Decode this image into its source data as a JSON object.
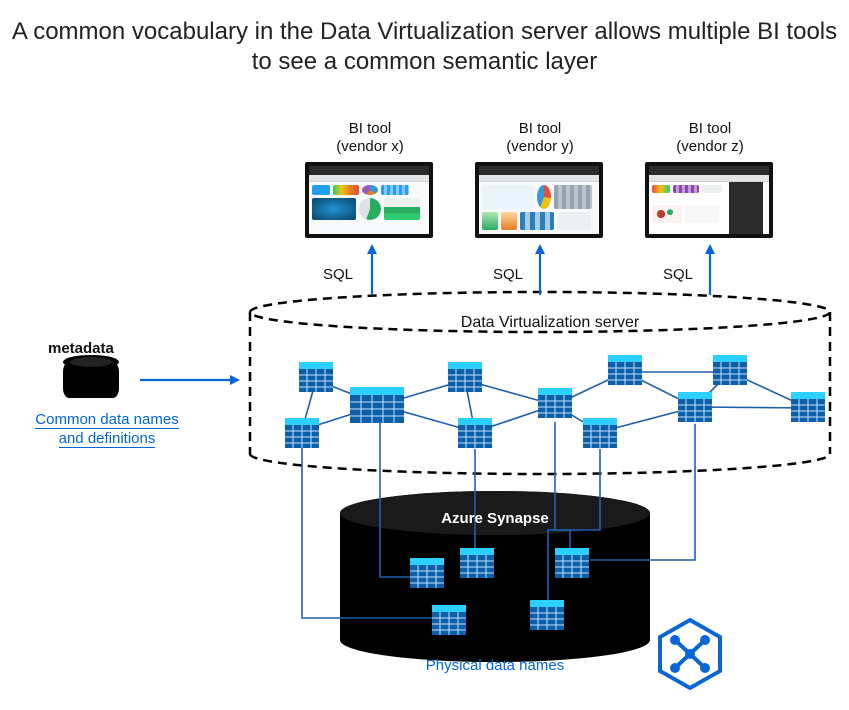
{
  "title": "A common vocabulary in the Data Virtualization server allows multiple BI tools to see a common semantic layer",
  "bi_tools": {
    "x": {
      "line1": "BI tool",
      "line2": "(vendor x)"
    },
    "y": {
      "line1": "BI tool",
      "line2": "(vendor y)"
    },
    "z": {
      "line1": "BI tool",
      "line2": "(vendor z)"
    }
  },
  "sql_label": "SQL",
  "metadata_label": "metadata",
  "common_data_link_l1": "Common",
  "common_data_link_l2": " data names",
  "common_data_link_l3": "and definitions",
  "dv_server_label": "Data Virtualization server",
  "azure_synapse_label": "Azure Synapse",
  "physical_label": "Physical data names",
  "colors": {
    "accent_blue": "#0a66d6",
    "table_header": "#29c0ff",
    "table_cell": "#1f78c8",
    "cylinder": "#000000"
  },
  "icons": {
    "synapse": "synapse-hexagon-icon",
    "database": "database-cylinder-icon",
    "table": "data-table-icon",
    "arrow": "arrow-icon"
  }
}
